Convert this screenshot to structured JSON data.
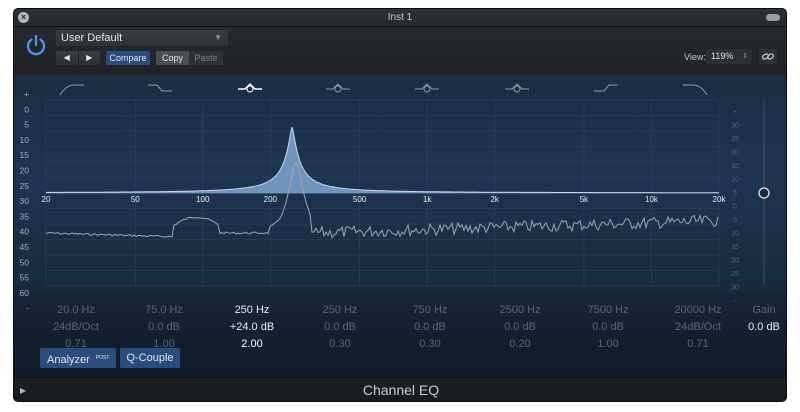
{
  "window": {
    "title": "Inst 1",
    "close_glyph": "×"
  },
  "header": {
    "preset": "User Default",
    "prev_glyph": "◀",
    "next_glyph": "▶",
    "compare_label": "Compare",
    "copy_label": "Copy",
    "paste_label": "Paste",
    "view_label": "View:",
    "zoom_value": "119%"
  },
  "left_scale": [
    "+",
    "0",
    "5",
    "10",
    "15",
    "20",
    "25",
    "30",
    "35",
    "40",
    "45",
    "50",
    "55",
    "60",
    "-"
  ],
  "right_scale": [
    "+",
    "30",
    "25",
    "20",
    "15",
    "10",
    "5",
    "0",
    "5",
    "10",
    "15",
    "20",
    "25",
    "30",
    "-"
  ],
  "freq_labels": [
    "20",
    "50",
    "100",
    "200",
    "500",
    "1k",
    "2k",
    "5k",
    "10k",
    "20k"
  ],
  "bands": [
    {
      "freq": "20.0 Hz",
      "gain": "24dB/Oct",
      "q": "0.71",
      "active": false,
      "icon": "low-cut-icon"
    },
    {
      "freq": "75.0 Hz",
      "gain": "0.0 dB",
      "q": "1.00",
      "active": false,
      "icon": "low-shelf-icon"
    },
    {
      "freq": "250 Hz",
      "gain": "+24.0 dB",
      "q": "2.00",
      "active": true,
      "icon": "bell-icon"
    },
    {
      "freq": "250 Hz",
      "gain": "0.0 dB",
      "q": "0.30",
      "active": false,
      "icon": "bell-icon"
    },
    {
      "freq": "750 Hz",
      "gain": "0.0 dB",
      "q": "0.30",
      "active": false,
      "icon": "bell-icon"
    },
    {
      "freq": "2500 Hz",
      "gain": "0.0 dB",
      "q": "0.20",
      "active": false,
      "icon": "bell-icon"
    },
    {
      "freq": "7500 Hz",
      "gain": "0.0 dB",
      "q": "1.00",
      "active": false,
      "icon": "high-shelf-icon"
    },
    {
      "freq": "20000 Hz",
      "gain": "24dB/Oct",
      "q": "0.71",
      "active": false,
      "icon": "high-cut-icon"
    }
  ],
  "gain": {
    "label": "Gain",
    "value": "0.0 dB"
  },
  "analyzer": {
    "label": "Analyzer",
    "badge": "POST"
  },
  "qcouple_label": "Q-Couple",
  "footer_title": "Channel EQ",
  "footer_play": "▶",
  "colors": {
    "accent_blue": "#2b4d7d",
    "curve_fill": "#7fa6cf",
    "analyzer_line": "#9aa7b6"
  }
}
